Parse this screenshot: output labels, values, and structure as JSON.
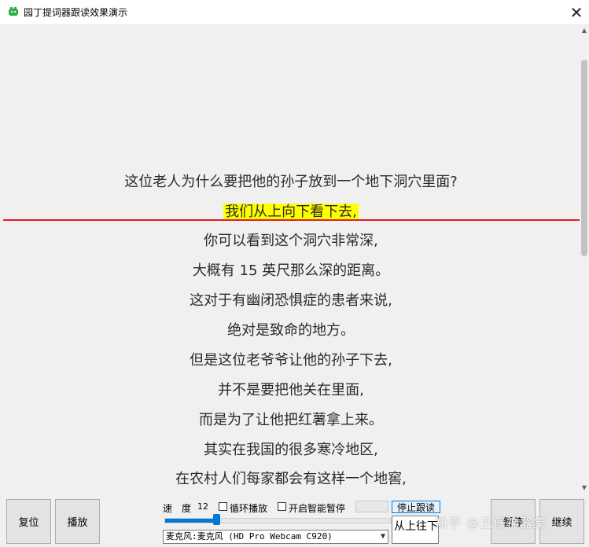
{
  "window": {
    "title": "园丁提词器跟读效果演示",
    "close_glyph": "✕"
  },
  "reader": {
    "lines": [
      "这位老人为什么要把他的孙子放到一个地下洞穴里面?",
      "我们从上向下看下去,",
      "你可以看到这个洞穴非常深,",
      "大概有 15 英尺那么深的距离。",
      "这对于有幽闭恐惧症的患者来说,",
      "绝对是致命的地方。",
      "但是这位老爷爷让他的孙子下去,",
      "并不是要把他关在里面,",
      "而是为了让他把红薯拿上来。",
      "其实在我国的很多寒冷地区,",
      "在农村人们每家都会有这样一个地窖,"
    ],
    "highlighted_index": 1,
    "highlight_color": "#ffff00",
    "guide_line_color": "#e02020"
  },
  "controls": {
    "reset_label": "复位",
    "play_label": "播放",
    "speed_label": "速　度",
    "speed_value": "12",
    "loop_label": "循环播放",
    "smart_pause_label": "开启智能暂停",
    "stop_follow_label": "停止跟读",
    "from_top_label": "从上往下",
    "mic_select_value": "麦克风:麦克风 (HD Pro Webcam C920)",
    "right_btn_1_label": "暂停",
    "right_btn_2_label": "继续",
    "speed_slider_fraction": 0.23,
    "accent_color": "#0078d7"
  },
  "watermark": "知乎 @王仔神器集"
}
